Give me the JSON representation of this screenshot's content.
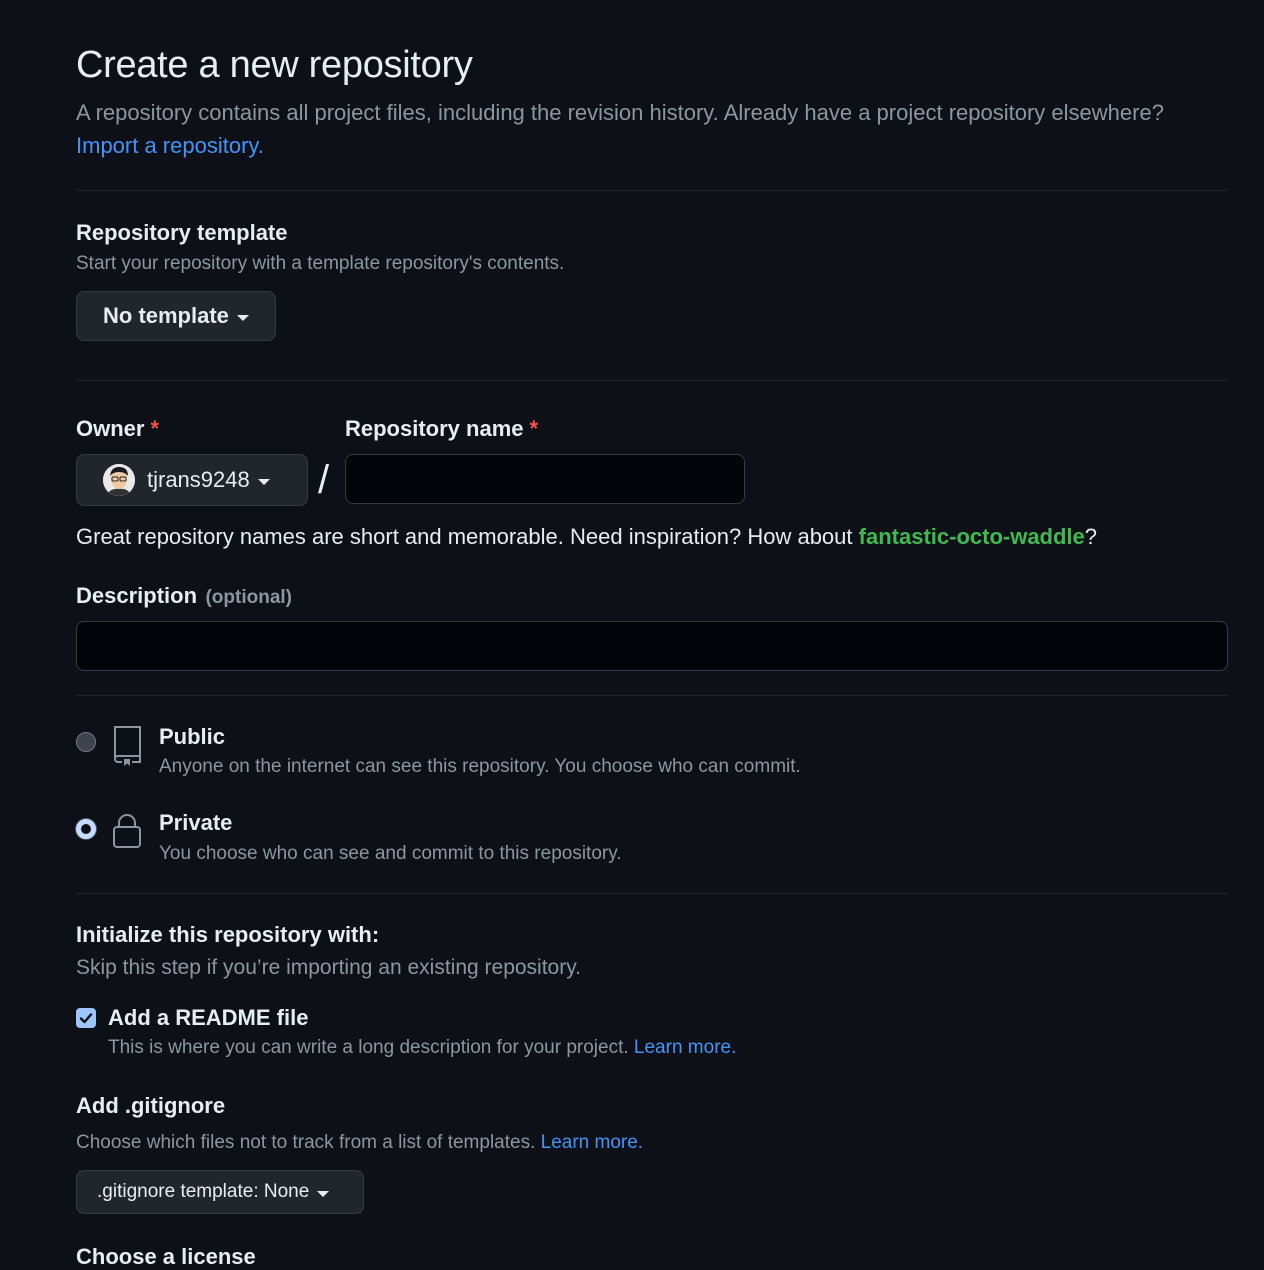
{
  "header": {
    "title": "Create a new repository",
    "lead_text": "A repository contains all project files, including the revision history. Already have a project repository elsewhere?",
    "import_link": "Import a repository."
  },
  "template": {
    "heading": "Repository template",
    "help": "Start your repository with a template repository's contents.",
    "button_label": "No template"
  },
  "owner": {
    "label": "Owner",
    "required_mark": "*",
    "selected": "tjrans9248"
  },
  "repo_name": {
    "label": "Repository name",
    "required_mark": "*",
    "value": "",
    "separator": "/"
  },
  "suggestion": {
    "text": "Great repository names are short and memorable. Need inspiration? How about",
    "name": "fantastic-octo-waddle",
    "suffix": "?"
  },
  "description": {
    "label": "Description",
    "optional": "(optional)",
    "value": ""
  },
  "visibility": {
    "options": [
      {
        "label": "Public",
        "help": "Anyone on the internet can see this repository. You choose who can commit.",
        "selected": false,
        "icon": "repo-icon"
      },
      {
        "label": "Private",
        "help": "You choose who can see and commit to this repository.",
        "selected": true,
        "icon": "lock-icon"
      }
    ]
  },
  "init": {
    "heading": "Initialize this repository with:",
    "help": "Skip this step if you’re importing an existing repository.",
    "readme": {
      "label": "Add a README file",
      "checked": true,
      "help": "This is where you can write a long description for your project.",
      "learn_more": "Learn more."
    }
  },
  "gitignore": {
    "heading": "Add .gitignore",
    "help": "Choose which files not to track from a list of templates.",
    "learn_more": "Learn more.",
    "button_label": ".gitignore template: None"
  },
  "license": {
    "heading": "Choose a license"
  },
  "colors": {
    "background": "#0d1117",
    "link": "#4493f8",
    "suggestion_green": "#3fb950",
    "required_red": "#f85149"
  }
}
